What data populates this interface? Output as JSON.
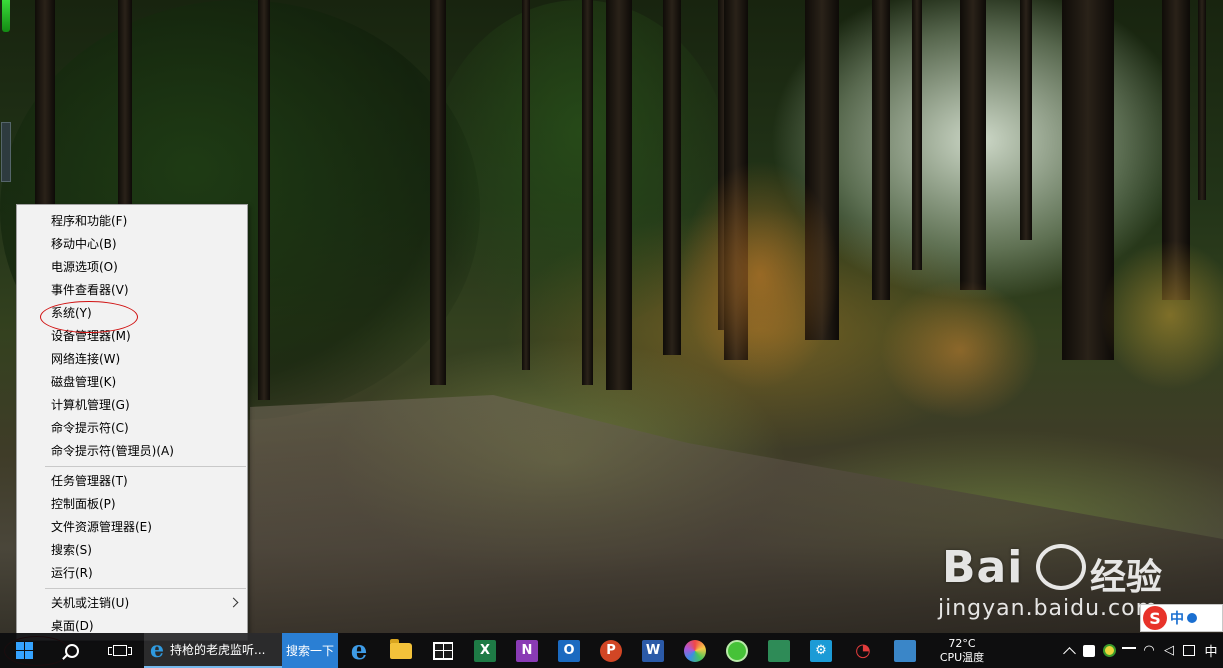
{
  "context_menu": {
    "items_group1": [
      "程序和功能(F)",
      "移动中心(B)",
      "电源选项(O)",
      "事件查看器(V)",
      "系统(Y)",
      "设备管理器(M)",
      "网络连接(W)",
      "磁盘管理(K)",
      "计算机管理(G)",
      "命令提示符(C)",
      "命令提示符(管理员)(A)"
    ],
    "items_group2": [
      "任务管理器(T)",
      "控制面板(P)",
      "文件资源管理器(E)",
      "搜索(S)",
      "运行(R)"
    ],
    "items_group3": [
      "关机或注销(U)",
      "桌面(D)"
    ]
  },
  "taskbar": {
    "ie_window_label": "持枪的老虎监听...",
    "search_app_label": "搜索一下",
    "app_letters": {
      "excel": "X",
      "onenote": "N",
      "outlook": "O",
      "powerpoint": "P",
      "word": "W"
    },
    "temperature": "72°C",
    "temperature_label": "CPU温度",
    "ime_language": "中"
  },
  "ime_widget": {
    "logo": "S",
    "mode": "中"
  },
  "watermark": {
    "brand": "Bai",
    "cn": "经验",
    "url": "jingyan.baidu.com"
  },
  "colors": {
    "windows_logo": "#35a3ff",
    "annotation": "#d01010",
    "taskbar": "#0c0c0e"
  }
}
